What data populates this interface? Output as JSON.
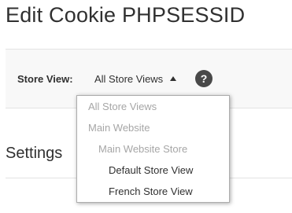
{
  "page": {
    "title": "Edit Cookie PHPSESSID"
  },
  "store_bar": {
    "label": "Store View:",
    "selected": "All Store Views",
    "help_icon": "question-mark-icon",
    "help_glyph": "?"
  },
  "store_dropdown": {
    "items": [
      {
        "label": "All Store Views",
        "enabled": false
      },
      {
        "label": "Main Website",
        "enabled": false
      },
      {
        "label": "Main Website Store",
        "enabled": false
      },
      {
        "label": "Default Store View",
        "enabled": true
      },
      {
        "label": "French Store View",
        "enabled": true
      }
    ]
  },
  "settings": {
    "title": "Settings"
  },
  "colors": {
    "text": "#303030",
    "disabled_text": "#a6a6a6",
    "bar_background": "#f8f8f8",
    "help_icon_bg": "#494949"
  }
}
